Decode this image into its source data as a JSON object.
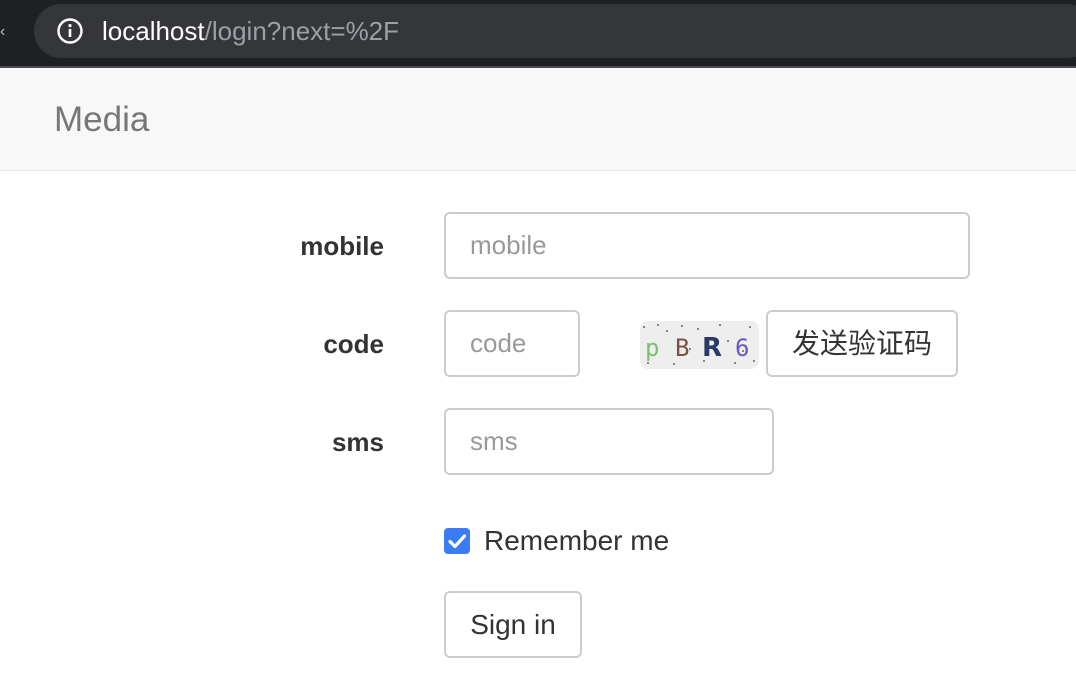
{
  "browser": {
    "url_host": "localhost",
    "url_path": "/login?next=%2F",
    "info_icon": "info-icon"
  },
  "navbar": {
    "brand": "Media"
  },
  "form": {
    "mobile": {
      "label": "mobile",
      "placeholder": "mobile",
      "value": ""
    },
    "code": {
      "label": "code",
      "placeholder": "code",
      "value": ""
    },
    "captcha_text": "pBR6",
    "send_code_button": "发送验证码",
    "sms": {
      "label": "sms",
      "placeholder": "sms",
      "value": ""
    },
    "remember_label": "Remember me",
    "remember_checked": true,
    "submit_label": "Sign in"
  },
  "colors": {
    "checkbox_accent": "#3b7cf5",
    "navbar_bg": "#f8f8f8",
    "chrome_bg": "#1f2023"
  }
}
